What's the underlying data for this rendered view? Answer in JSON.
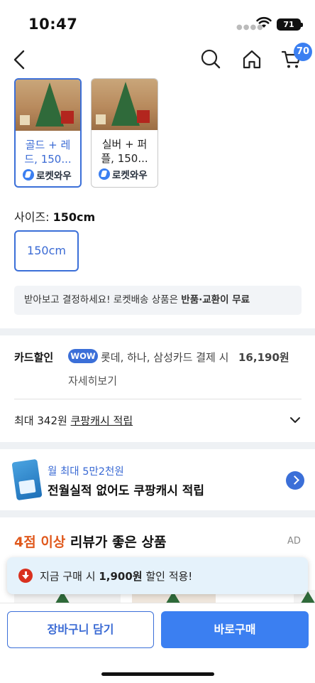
{
  "status_bar": {
    "time": "10:47",
    "battery": "71"
  },
  "nav": {
    "cart_count": "70"
  },
  "options": [
    {
      "name_line1": "골드 + 레",
      "name_line2": "드, 150...",
      "badge": "로켓와우",
      "selected": true
    },
    {
      "name_line1": "실버 + 퍼",
      "name_line2": "플, 150...",
      "badge": "로켓와우",
      "selected": false
    }
  ],
  "size": {
    "label": "사이즈: ",
    "value": "150cm",
    "option": "150cm"
  },
  "notice": {
    "text": "받아보고 결정하세요! 로켓배송 상품은 ",
    "bold": "반품·교환이 무료"
  },
  "card_discount": {
    "title": "카드할인",
    "badge": "WOW",
    "text": "롯데, 하나, 삼성카드 결제 시",
    "amount": "16,190원",
    "detail_link": "자세히보기"
  },
  "cash": {
    "prefix": "최대 342원 ",
    "link": "쿠팡캐시 적립"
  },
  "promo": {
    "subtitle": "월 최대 5만2천원",
    "title": "전월실적 없어도 쿠팡캐시 적립"
  },
  "recommendation": {
    "accent": "4점 이상",
    "title": " 리뷰가 좋은 상품",
    "ad": "AD"
  },
  "toast": {
    "prefix": "지금 구매 시 ",
    "amount": "1,900원",
    "suffix": " 할인 적용!"
  },
  "bottom": {
    "cart_button": "장바구니 담기",
    "buy_button": "바로구매"
  }
}
